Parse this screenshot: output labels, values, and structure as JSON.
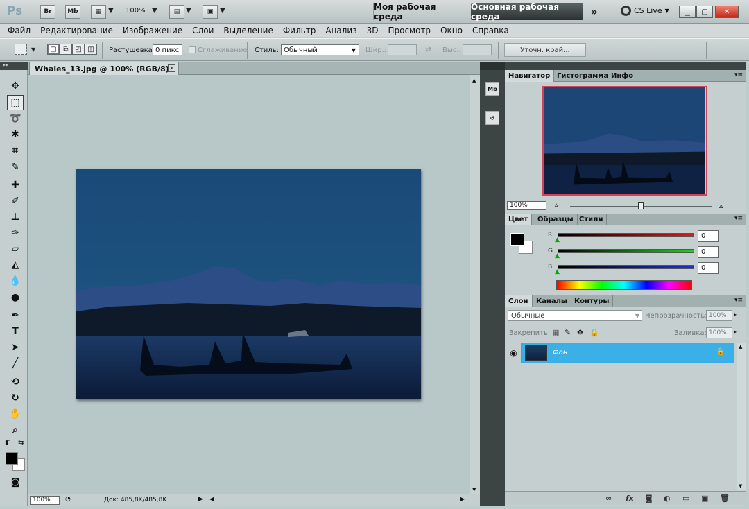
{
  "appbar": {
    "logo": "Ps",
    "bridge": "Br",
    "minibridge": "Mb",
    "zoom": "100%",
    "workspace_custom": "Моя рабочая среда",
    "workspace_main": "Основная рабочая среда",
    "cs_live": "CS Live"
  },
  "menu": [
    "Файл",
    "Редактирование",
    "Изображение",
    "Слои",
    "Выделение",
    "Фильтр",
    "Анализ",
    "3D",
    "Просмотр",
    "Окно",
    "Справка"
  ],
  "options": {
    "feather_label": "Растушевка:",
    "feather_value": "0 пикс",
    "antialias_label": "Сглаживание",
    "style_label": "Стиль:",
    "style_value": "Обычный",
    "width_label": "Шир.:",
    "height_label": "Выс.:",
    "refine_edge": "Уточн. край..."
  },
  "document": {
    "tab_title": "Whales_13.jpg @ 100% (RGB/8)",
    "status_zoom": "100%",
    "status_doc": "Док: 485,8K/485,8K"
  },
  "navigator": {
    "tabs": [
      "Навигатор",
      "Гистограмма",
      "Инфо"
    ],
    "zoom": "100%"
  },
  "color": {
    "tabs": [
      "Цвет",
      "Образцы",
      "Стили"
    ],
    "channels": [
      {
        "label": "R",
        "value": "0",
        "color": "#d42020"
      },
      {
        "label": "G",
        "value": "0",
        "color": "#20c020"
      },
      {
        "label": "B",
        "value": "0",
        "color": "#2030d0"
      }
    ]
  },
  "layers": {
    "tabs": [
      "Слои",
      "Каналы",
      "Контуры"
    ],
    "blend_mode": "Обычные",
    "opacity_label": "Непрозрачность:",
    "opacity_value": "100%",
    "lock_label": "Закрепить:",
    "fill_label": "Заливка:",
    "fill_value": "100%",
    "items": [
      {
        "name": "Фон"
      }
    ]
  }
}
